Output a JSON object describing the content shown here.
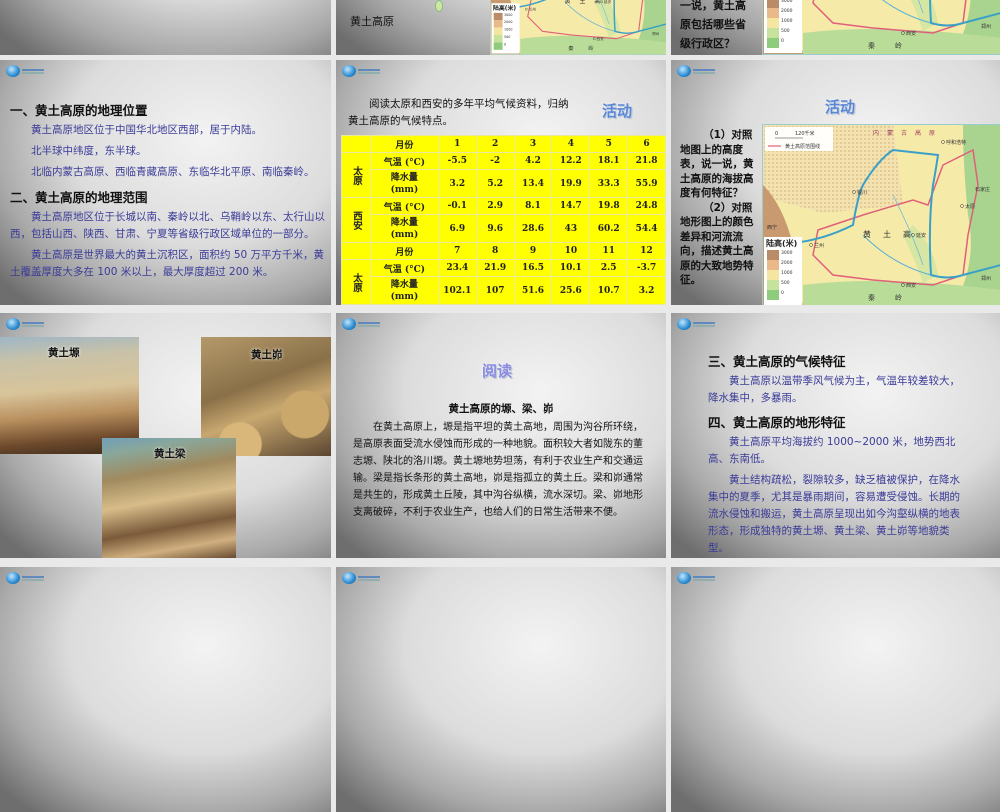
{
  "row1": {
    "slide2_caption": "黄土高原",
    "slide3_question_lines": [
      "一说，黄土高",
      "原包括哪些省",
      "级行政区？"
    ]
  },
  "location_slide": {
    "heading1": "一、黄土高原的地理位置",
    "p1": "黄土高原地区位于中国华北地区西部，居于内陆。",
    "p2": "北半球中纬度，东半球。",
    "p3": "北临内蒙古高原、西临青藏高原、东临华北平原、南临秦岭。",
    "heading2": "二、黄土高原的地理范围",
    "p4": "黄土高原地区位于长城以南、秦岭以北、乌鞘岭以东、太行山以西，包括山西、陕西、甘肃、宁夏等省级行政区域单位的一部分。",
    "p5": "黄土高原是世界最大的黄土沉积区，面积约 50 万平方千米，黄土覆盖厚度大多在 100 米以上，最大厚度超过 200 米。"
  },
  "climate_slide": {
    "intro": "阅读太原和西安的多年平均气候资料，归纳黄土高原的气候特点。",
    "activity_label": "活动",
    "table": {
      "month_label": "月份",
      "temp_label": "气温 (°C)",
      "precip_label": "降水量 (mm)",
      "blocks": [
        {
          "months": [
            "1",
            "2",
            "3",
            "4",
            "5",
            "6"
          ],
          "cities": [
            {
              "name": "太原",
              "temp": [
                "-5.5",
                "-2",
                "4.2",
                "12.2",
                "18.1",
                "21.8"
              ],
              "precip": [
                "3.2",
                "5.2",
                "13.4",
                "19.9",
                "33.3",
                "55.9"
              ]
            },
            {
              "name": "西安",
              "temp": [
                "-0.1",
                "2.9",
                "8.1",
                "14.7",
                "19.8",
                "24.8"
              ],
              "precip": [
                "6.9",
                "9.6",
                "28.6",
                "43",
                "60.2",
                "54.4"
              ]
            }
          ]
        },
        {
          "months": [
            "7",
            "8",
            "9",
            "10",
            "11",
            "12"
          ],
          "cities": [
            {
              "name": "太原",
              "temp": [
                "23.4",
                "21.9",
                "16.5",
                "10.1",
                "2.5",
                "-3.7"
              ],
              "precip": [
                "102.1",
                "107",
                "51.6",
                "25.6",
                "10.7",
                "3.2"
              ]
            }
          ]
        }
      ]
    }
  },
  "map_activity_slide": {
    "activity_label": "活动",
    "q1": "（1）对照地图上的高度表，说一说，黄土高原的海拔高度有何特征？",
    "q2": "（2）对照地形图上的颜色差异和河流流向，描述黄土高原的大致地势特征。"
  },
  "map": {
    "scale_zero": "0",
    "scale_label": "120千米",
    "boundary_legend": "黄土高原范围线",
    "legend_title": "陆高(米)",
    "legend_levels": [
      "3000",
      "2000",
      "1000",
      "500",
      "0"
    ],
    "legend_colors": [
      "#b98b66",
      "#e9b98a",
      "#f4e6a0",
      "#c7e29a",
      "#8fcb7c"
    ],
    "places": {
      "nmg": "内蒙古高原",
      "huhehaote": "呼和浩特",
      "yinchuan": "银川",
      "taiyuan": "太原",
      "shijiazhuang": "石家庄",
      "lanzhou": "兰州",
      "xining": "西宁",
      "yanan": "延安",
      "xian": "西安",
      "zhengzhou": "郑州",
      "loess": "黄土高",
      "qinling": "秦岭"
    }
  },
  "photos_slide": {
    "yuan": "黄土塬",
    "mao": "黄土峁",
    "liang": "黄土梁"
  },
  "reading_slide": {
    "label": "阅读",
    "title": "黄土高原的塬、梁、峁",
    "body": "在黄土高原上，塬是指平坦的黄土高地，周围为沟谷所环绕，是高原表面受流水侵蚀而形成的一种地貌。面积较大者如陇东的董志塬、陕北的洛川塬。黄土塬地势坦荡，有利于农业生产和交通运输。梁是指长条形的黄土高地，峁是指孤立的黄土丘。梁和峁通常是共生的，形成黄土丘陵，其中沟谷纵横，流水深切。梁、峁地形支离破碎，不利于农业生产，也给人们的日常生活带来不便。"
  },
  "features_slide": {
    "heading3": "三、黄土高原的气候特征",
    "p1": "黄土高原以温带季风气候为主，气温年较差较大，降水集中，多暴雨。",
    "heading4": "四、黄土高原的地形特征",
    "p2": "黄土高原平均海拔约 1000~2000 米，地势西北高、东南低。",
    "p3": "黄土结构疏松，裂隙较多，缺乏植被保护，在降水集中的夏季，尤其是暴雨期间，容易遭受侵蚀。长期的流水侵蚀和搬运，黄土高原呈现出如今沟壑纵横的地表形态，形成独特的黄土塬、黄土梁、黄土峁等地貌类型。"
  }
}
